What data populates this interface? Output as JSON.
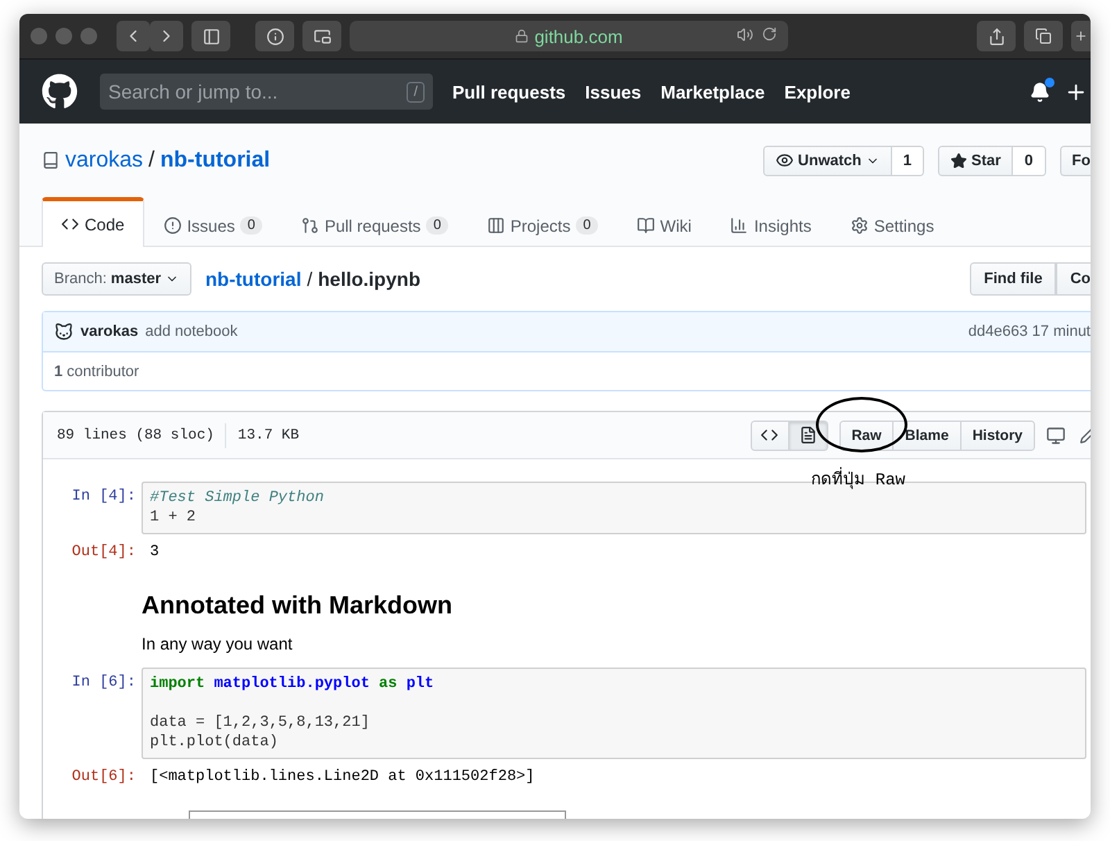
{
  "browser": {
    "url": "github.com"
  },
  "header": {
    "search": {
      "placeholder": "Search or jump to...",
      "shortcut": "/"
    },
    "nav": [
      "Pull requests",
      "Issues",
      "Marketplace",
      "Explore"
    ],
    "notifications_unread": true
  },
  "repo": {
    "owner": "varokas",
    "separator": "/",
    "name": "nb-tutorial",
    "actions": [
      {
        "kind": "watch",
        "label": "Unwatch",
        "count": "1"
      },
      {
        "kind": "star",
        "label": "Star",
        "count": "0"
      },
      {
        "kind": "fork",
        "label": "Fo"
      }
    ]
  },
  "tabs": [
    {
      "kind": "code",
      "label": "Code",
      "selected": true
    },
    {
      "kind": "issues",
      "label": "Issues",
      "count": "0",
      "selected": false
    },
    {
      "kind": "pulls",
      "label": "Pull requests",
      "count": "0",
      "selected": false
    },
    {
      "kind": "projects",
      "label": "Projects",
      "count": "0",
      "selected": false
    },
    {
      "kind": "wiki",
      "label": "Wiki",
      "selected": false
    },
    {
      "kind": "insights",
      "label": "Insights",
      "selected": false
    },
    {
      "kind": "settings",
      "label": "Settings",
      "selected": false
    }
  ],
  "file_nav": {
    "branch_label": "Branch:",
    "branch": "master",
    "repo_link": "nb-tutorial",
    "separator": "/",
    "file": "hello.ipynb",
    "buttons": [
      "Find file",
      "Co"
    ]
  },
  "commit": {
    "author": "varokas",
    "message": "add notebook",
    "sha": "dd4e663",
    "time": "17 minut",
    "contributors": "**1** contributor"
  },
  "file": {
    "lines": "89 lines (88 sloc)",
    "size": "13.7 KB",
    "views": [
      {
        "kind": "source",
        "selected": false
      },
      {
        "kind": "display",
        "selected": true
      }
    ],
    "buttons": [
      "Raw",
      "Blame",
      "History"
    ]
  },
  "annotation": {
    "text": "กดที่ปุ่ม Raw"
  },
  "cells": [
    {
      "kind": "code",
      "prompt": "In [4]:",
      "lines": [
        {
          "kind": "code",
          "tokens": [
            {
              "kind": "comment",
              "text": "#Test Simple Python"
            }
          ]
        },
        {
          "kind": "code",
          "tokens": [
            {
              "kind": "plain",
              "text": "1 + 2"
            }
          ]
        }
      ]
    },
    {
      "kind": "output",
      "prompt": "Out[4]:",
      "text": "3"
    },
    {
      "kind": "markdown",
      "heading": "Annotated with Markdown",
      "text": "In any way you want"
    },
    {
      "kind": "code",
      "prompt": "In [6]:",
      "lines": [
        {
          "kind": "code",
          "tokens": [
            {
              "kind": "keyword",
              "text": "import"
            },
            {
              "kind": "name",
              "text": "matplotlib.pyplot"
            },
            {
              "kind": "keyword",
              "text": "as"
            },
            {
              "kind": "name",
              "text": "plt"
            }
          ]
        },
        {
          "kind": "blank"
        },
        {
          "kind": "code",
          "tokens": [
            {
              "kind": "plain",
              "text": "data = [1,2,3,5,8,13,21]"
            }
          ]
        },
        {
          "kind": "code",
          "tokens": [
            {
              "kind": "plain",
              "text": "plt.plot(data)"
            }
          ]
        }
      ]
    },
    {
      "kind": "output",
      "prompt": "Out[6]:",
      "text": "[<matplotlib.lines.Line2D at 0x111502f28>]"
    },
    {
      "kind": "image"
    }
  ]
}
